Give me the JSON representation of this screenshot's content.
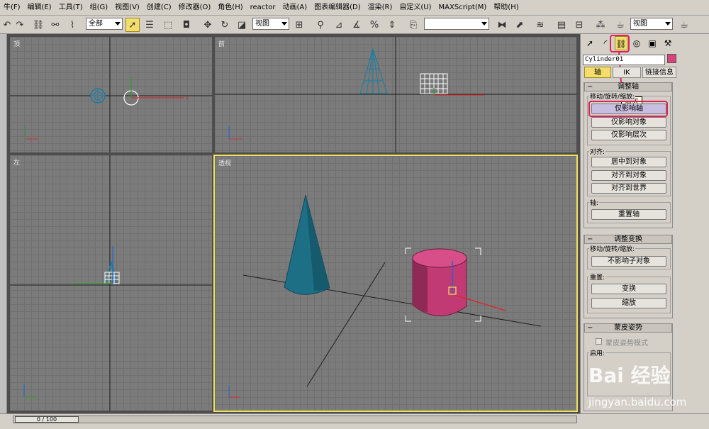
{
  "menubar": [
    "牛(F)",
    "编辑(E)",
    "工具(T)",
    "组(G)",
    "视图(V)",
    "创建(C)",
    "修改器(O)",
    "角色(H)",
    "reactor",
    "动画(A)",
    "图表编辑器(D)",
    "渲染(R)",
    "自定义(U)",
    "MAXScript(M)",
    "帮助(H)"
  ],
  "toolbar": {
    "selection_filter": "全部",
    "reference_coord": "视图",
    "named_selection": "",
    "render_view": "视图"
  },
  "viewports": {
    "top": {
      "label": "顶"
    },
    "front": {
      "label": "前"
    },
    "left": {
      "label": "左"
    },
    "perspective": {
      "label": "透视"
    }
  },
  "command_panel": {
    "object_name": "Cylinder01",
    "object_color": "#d9427a",
    "tooltip": "层次",
    "tabs": {
      "pivot": "轴",
      "ik": "IK",
      "link_info": "链接信息"
    },
    "adjust_pivot": {
      "title": "调整轴",
      "move_group_label": "移动/旋转/缩放:",
      "affect_pivot_only": "仅影响轴",
      "affect_object_only": "仅影响对象",
      "affect_hierarchy_only": "仅影响层次",
      "align_group_label": "对齐:",
      "center_to_object": "居中到对象",
      "align_to_object": "对齐到对象",
      "align_to_world": "对齐到世界",
      "pivot_group_label": "轴:",
      "reset_pivot": "重置轴"
    },
    "adjust_transform": {
      "title": "调整变换",
      "move_group_label": "移动/旋转/缩放:",
      "dont_affect_children": "不影响子对象",
      "reset_group_label": "重置:",
      "transform": "变换",
      "scale": "缩放"
    },
    "skin_pose": {
      "title": "蒙皮姿势",
      "skin_pose_mode": "蒙皮姿势模式",
      "enabled_label": "启用:"
    }
  },
  "status": {
    "time_display": "0 / 100"
  },
  "watermark": {
    "logo": "Bai 经验",
    "url": "jingyan.baidu.com"
  },
  "colors": {
    "highlight": "#e0205a",
    "active_viewport": "#f2e15c",
    "cone": "#1d6f86",
    "cylinder": "#c23a74"
  }
}
